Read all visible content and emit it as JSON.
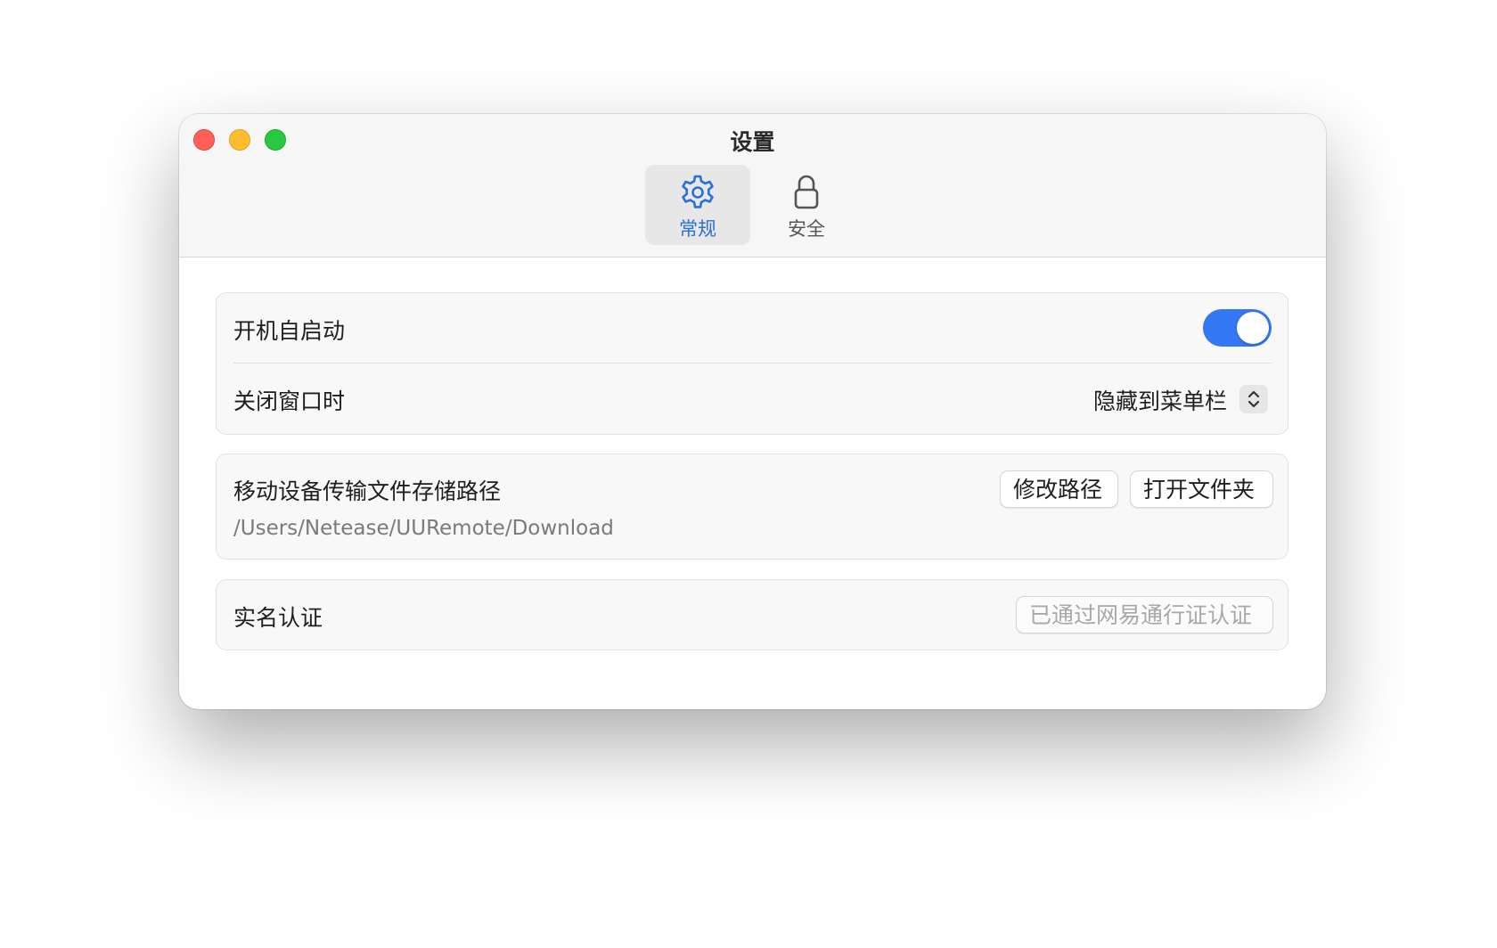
{
  "window": {
    "title": "设置"
  },
  "tabs": [
    {
      "label": "常规",
      "icon": "gear-icon",
      "active": true
    },
    {
      "label": "安全",
      "icon": "lock-icon",
      "active": false
    }
  ],
  "general": {
    "autostart": {
      "label": "开机自启动",
      "enabled": true
    },
    "close_window": {
      "label": "关闭窗口时",
      "value": "隐藏到菜单栏"
    },
    "transfer_path": {
      "label": "移动设备传输文件存储路径",
      "path": "/Users/Netease/UURemote/Download",
      "modify_button": "修改路径",
      "open_button": "打开文件夹"
    },
    "realname": {
      "label": "实名认证",
      "status": "已通过网易通行证认证"
    }
  },
  "colors": {
    "accent": "#3478f6",
    "active_tab_text": "#2b70d8",
    "traffic_close": "#fe5f57",
    "traffic_minimize": "#febc2e",
    "traffic_maximize": "#28c840"
  }
}
